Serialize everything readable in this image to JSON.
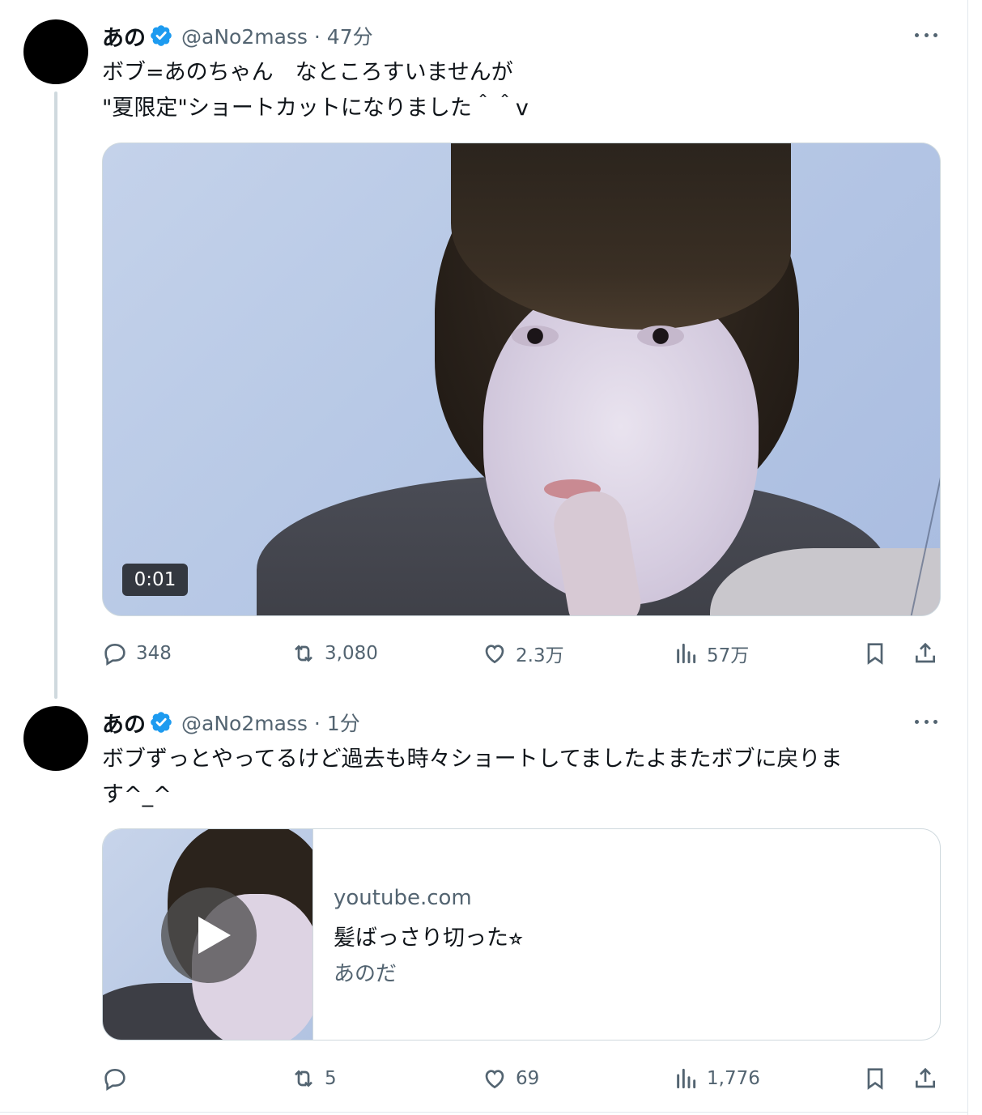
{
  "tweets": [
    {
      "name": "あの",
      "handle_time": "@aNo2mass · 47分",
      "text_lines": [
        "ボブ=あのちゃん　なところすいませんが",
        "\"夏限定\"ショートカットになりました＾＾v"
      ],
      "media": {
        "timecode": "0:01"
      },
      "stats": {
        "replies": "348",
        "reposts": "3,080",
        "likes": "2.3万",
        "views": "57万"
      }
    },
    {
      "name": "あの",
      "handle_time": "@aNo2mass · 1分",
      "text_lines": [
        "ボブずっとやってるけど過去も時々ショートしてましたよまたボブに戻りま",
        "す^_^"
      ],
      "card": {
        "domain": "youtube.com",
        "title": "髪ばっさり切った⭐︎",
        "description": "あのだ"
      },
      "stats": {
        "replies": "",
        "reposts": "5",
        "likes": "69",
        "views": "1,776"
      }
    }
  ],
  "colors": {
    "verified": "#1d9bf0",
    "secondary_text": "#536471",
    "primary_text": "#0f1419",
    "border": "#cfd9de"
  },
  "icons": [
    "verified-badge-icon",
    "more-icon",
    "reply-icon",
    "repost-icon",
    "like-icon",
    "views-icon",
    "bookmark-icon",
    "share-icon",
    "play-icon"
  ]
}
